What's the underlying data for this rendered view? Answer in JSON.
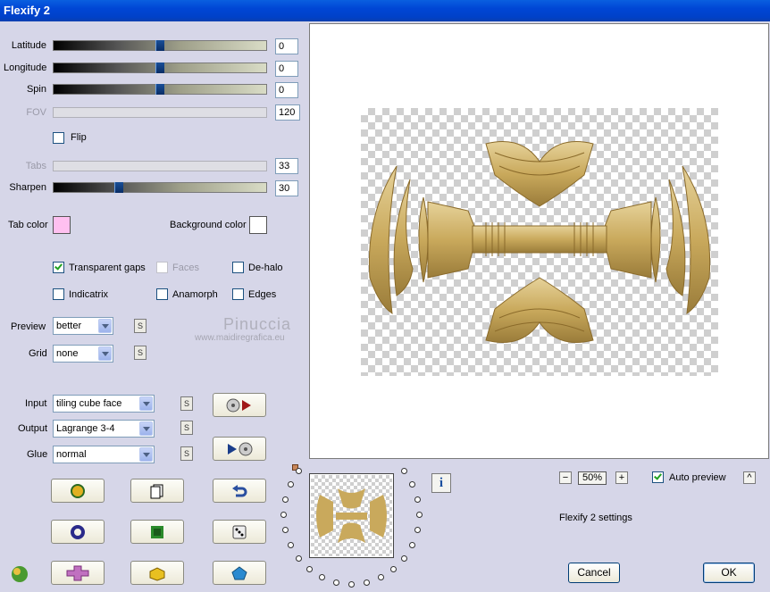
{
  "window": {
    "title": "Flexify 2"
  },
  "sliders": [
    {
      "label": "Latitude",
      "value": "0",
      "level": 0.5,
      "disabled": false
    },
    {
      "label": "Longitude",
      "value": "0",
      "level": 0.5,
      "disabled": false
    },
    {
      "label": "Spin",
      "value": "0",
      "level": 0.5,
      "disabled": false
    },
    {
      "label": "FOV",
      "value": "120",
      "disabled": true
    },
    {
      "label": "Tabs",
      "value": "33",
      "disabled": true
    },
    {
      "label": "Sharpen",
      "value": "30",
      "level": 0.3,
      "disabled": false
    }
  ],
  "flip": {
    "label": "Flip",
    "checked": false
  },
  "colors": {
    "tab_color_label": "Tab color",
    "tab_color": "#ffc0f0",
    "background_color_label": "Background color",
    "background_color": "#ffffff"
  },
  "options": {
    "transparent_gaps": {
      "label": "Transparent gaps",
      "checked": true
    },
    "faces": {
      "label": "Faces",
      "checked": false,
      "disabled": true
    },
    "de_halo": {
      "label": "De-halo",
      "checked": false
    },
    "indicatrix": {
      "label": "Indicatrix",
      "checked": false
    },
    "anamorph": {
      "label": "Anamorph",
      "checked": false
    },
    "edges": {
      "label": "Edges",
      "checked": false
    }
  },
  "selects": {
    "preview": {
      "label": "Preview",
      "value": "better"
    },
    "grid": {
      "label": "Grid",
      "value": "none"
    },
    "input": {
      "label": "Input",
      "value": "tiling cube face"
    },
    "output": {
      "label": "Output",
      "value": "Lagrange 3-4"
    },
    "glue": {
      "label": "Glue",
      "value": "normal"
    }
  },
  "watermark": {
    "name": "Pinuccia",
    "url": "www.maidiregrafica.eu"
  },
  "zoom": {
    "value": "50%",
    "minus": "−",
    "plus": "+"
  },
  "auto_preview": {
    "label": "Auto preview",
    "checked": true
  },
  "settings_name": "Flexify 2 settings",
  "buttons": {
    "cancel": "Cancel",
    "ok": "OK",
    "s": "S",
    "info": "i",
    "collapse": "^"
  }
}
